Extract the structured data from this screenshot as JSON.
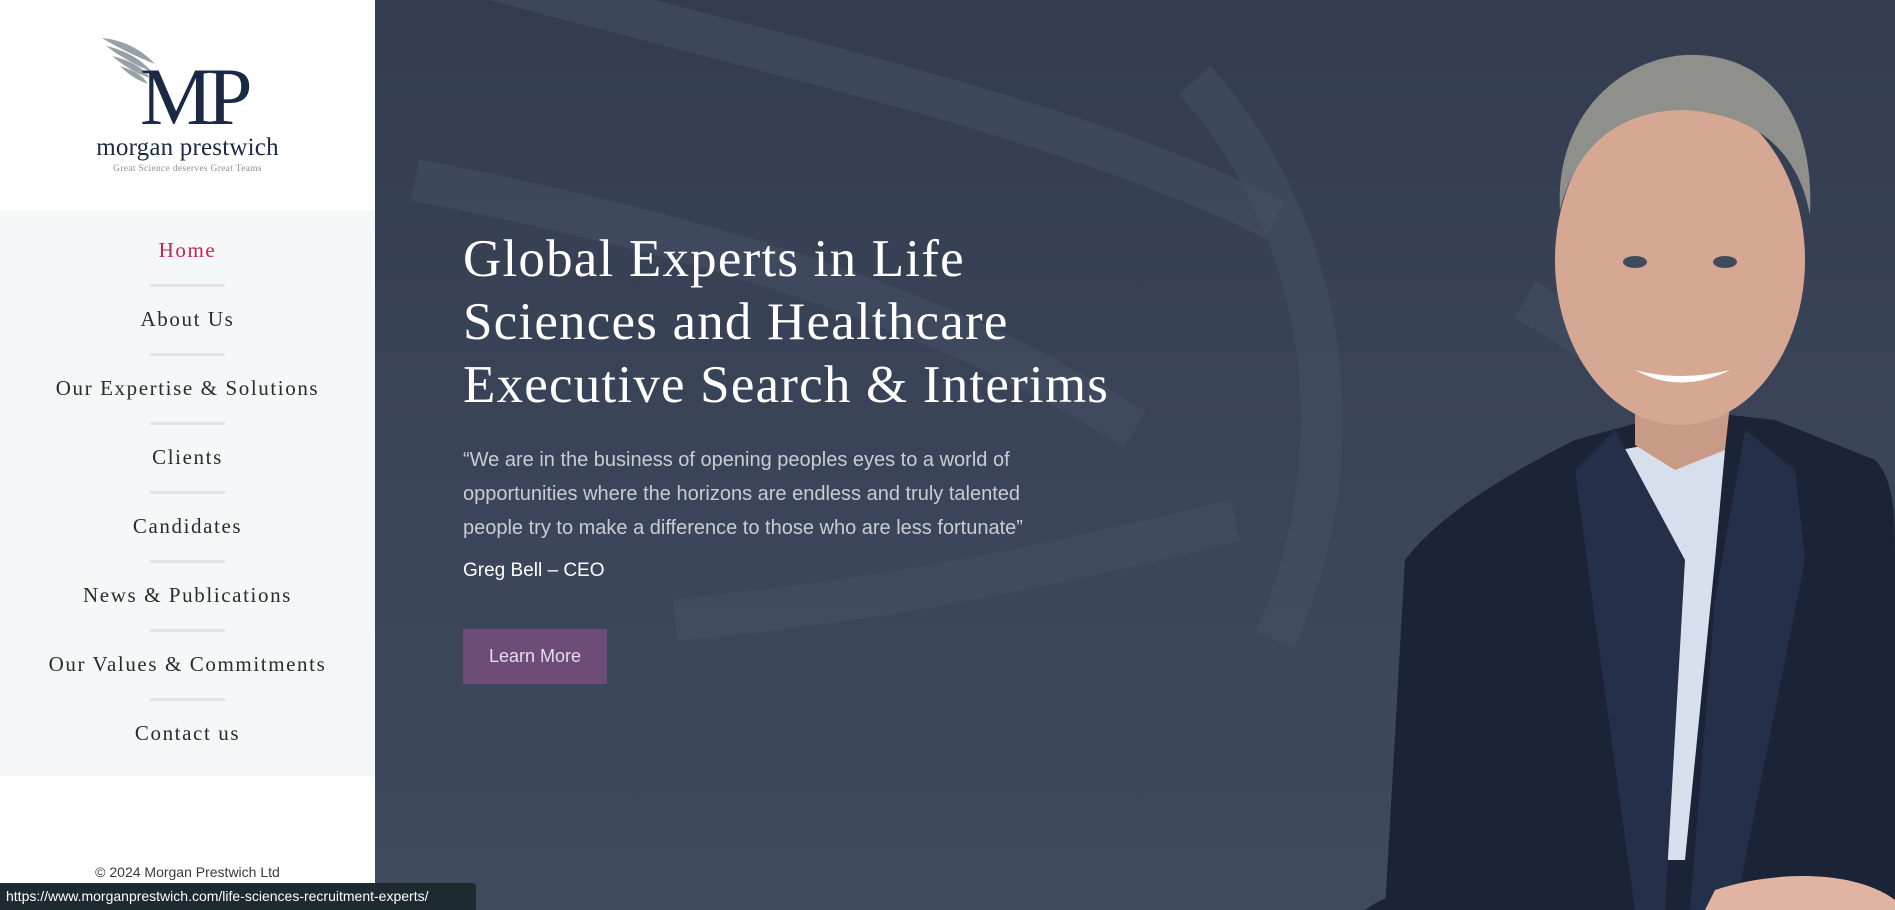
{
  "brand": {
    "logo_letters": "MP",
    "name": "morgan prestwich",
    "tagline": "Great Science deserves Great Teams",
    "colors": {
      "navy": "#1b2a44",
      "accent": "#c2264f",
      "button": "#6d4d77",
      "hero_bg": "#3b4559"
    }
  },
  "nav": {
    "items": [
      {
        "label": "Home",
        "active": true
      },
      {
        "label": "About Us"
      },
      {
        "label": "Our Expertise & Solutions"
      },
      {
        "label": "Clients"
      },
      {
        "label": "Candidates"
      },
      {
        "label": "News & Publications"
      },
      {
        "label": "Our Values & Commitments"
      },
      {
        "label": "Contact us"
      }
    ]
  },
  "hero": {
    "title_lines": [
      "Global Experts in Life",
      "Sciences and Healthcare",
      "Executive Search & Interims"
    ],
    "quote": "“We are in the business of opening peoples eyes to a world of opportunities where the horizons are endless and truly talented people try to make a difference to those who are less fortunate”",
    "author": "Greg Bell – CEO",
    "cta_label": "Learn More"
  },
  "footer": {
    "copyright": "© 2024 Morgan Prestwich Ltd"
  },
  "status_bar": {
    "url": "https://www.morganprestwich.com/life-sciences-recruitment-experts/"
  }
}
